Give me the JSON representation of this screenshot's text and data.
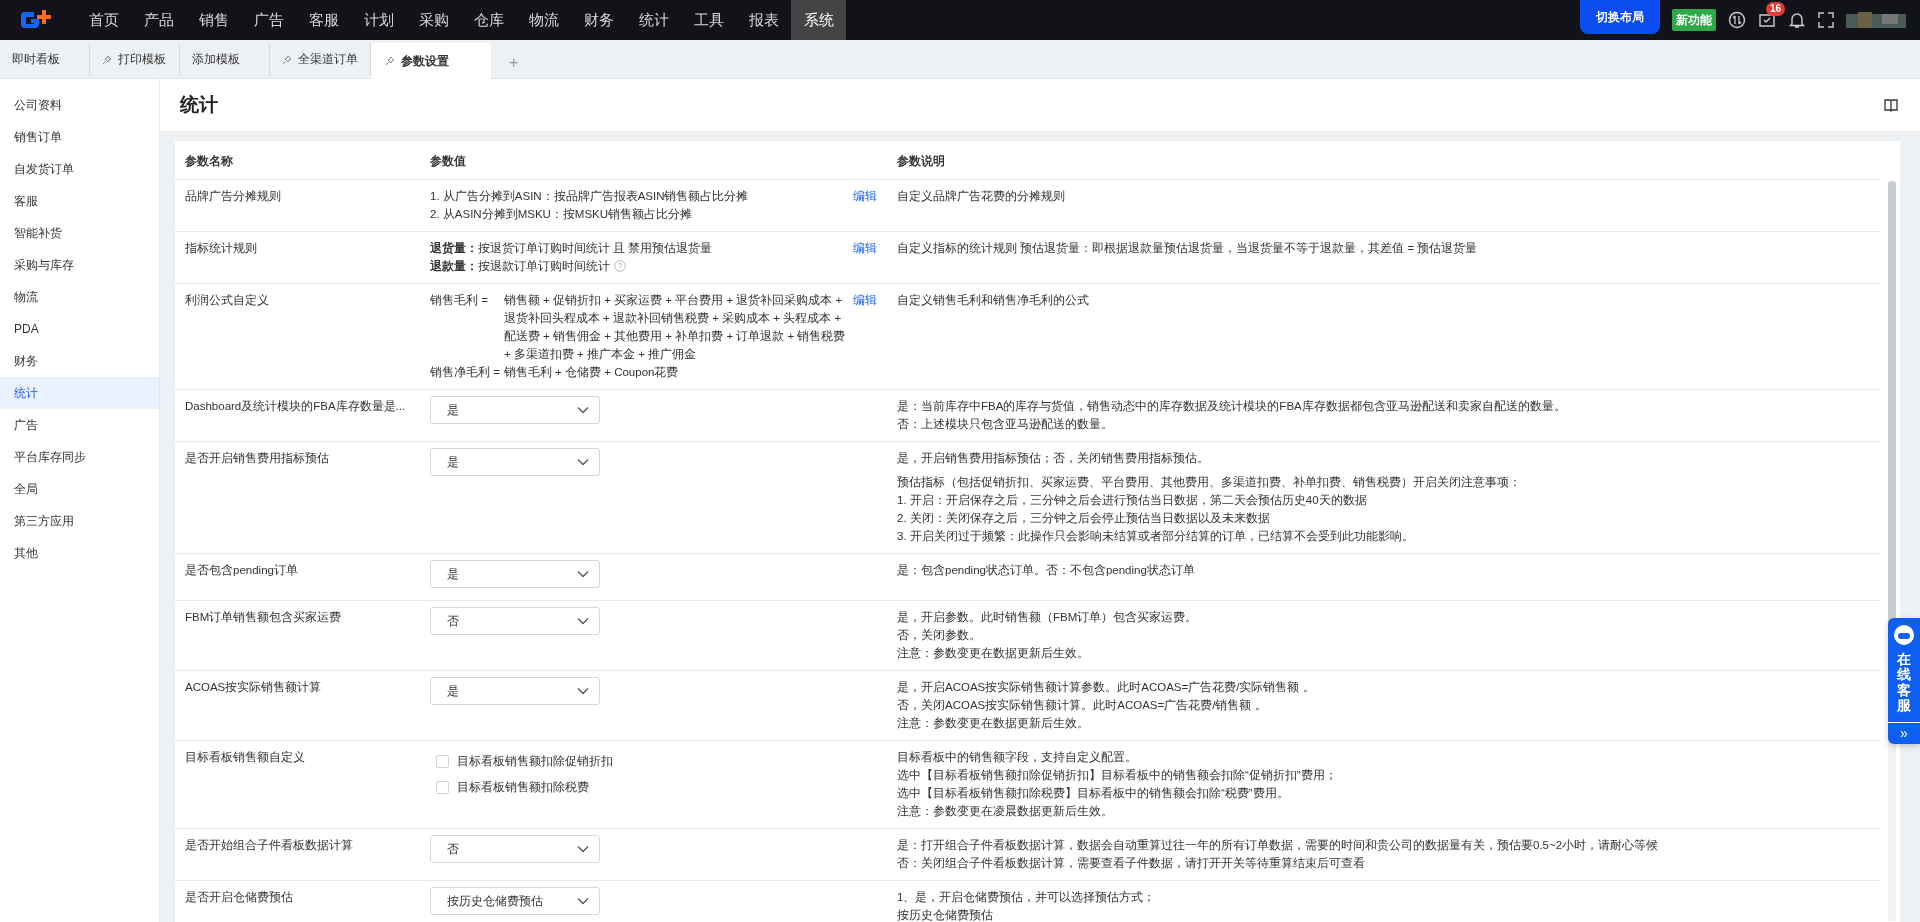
{
  "top_nav": {
    "items": [
      {
        "label": "首页",
        "selected": false
      },
      {
        "label": "产品",
        "selected": false
      },
      {
        "label": "销售",
        "selected": false
      },
      {
        "label": "广告",
        "selected": false
      },
      {
        "label": "客服",
        "selected": false
      },
      {
        "label": "计划",
        "selected": false
      },
      {
        "label": "采购",
        "selected": false
      },
      {
        "label": "仓库",
        "selected": false
      },
      {
        "label": "物流",
        "selected": false
      },
      {
        "label": "财务",
        "selected": false
      },
      {
        "label": "统计",
        "selected": false
      },
      {
        "label": "工具",
        "selected": false
      },
      {
        "label": "报表",
        "selected": false
      },
      {
        "label": "系统",
        "selected": true
      }
    ],
    "switch_layout": "切换布局",
    "new_feature": "新功能",
    "notification_count": "16"
  },
  "tabs": [
    {
      "label": "即时看板",
      "pinned": false,
      "selected": false
    },
    {
      "label": "打印模板",
      "pinned": true,
      "selected": false
    },
    {
      "label": "添加模板",
      "pinned": false,
      "selected": false
    },
    {
      "label": "全渠道订单",
      "pinned": true,
      "selected": false
    },
    {
      "label": "参数设置",
      "pinned": true,
      "selected": true
    }
  ],
  "add_tab": "+",
  "sidebar": {
    "items": [
      {
        "label": "公司资料",
        "selected": false
      },
      {
        "label": "销售订单",
        "selected": false
      },
      {
        "label": "自发货订单",
        "selected": false
      },
      {
        "label": "客服",
        "selected": false
      },
      {
        "label": "智能补货",
        "selected": false
      },
      {
        "label": "采购与库存",
        "selected": false
      },
      {
        "label": "物流",
        "selected": false
      },
      {
        "label": "PDA",
        "selected": false
      },
      {
        "label": "财务",
        "selected": false
      },
      {
        "label": "统计",
        "selected": true
      },
      {
        "label": "广告",
        "selected": false
      },
      {
        "label": "平台库存同步",
        "selected": false
      },
      {
        "label": "全局",
        "selected": false
      },
      {
        "label": "第三方应用",
        "selected": false
      },
      {
        "label": "其他",
        "selected": false
      }
    ]
  },
  "page": {
    "title": "统计"
  },
  "table": {
    "columns": [
      "参数名称",
      "参数值",
      "参数说明"
    ],
    "rows": [
      {
        "name": "品牌广告分摊规则",
        "kind": "rule",
        "lines": [
          {
            "text": "1. 从广告分摊到ASIN：按品牌广告报表ASIN销售额占比分摊",
            "help": false
          },
          {
            "text": "2. 从ASIN分摊到MSKU：按MSKU销售额占比分摊",
            "help": false
          }
        ],
        "edit": "编辑",
        "description": [
          [
            "自定义品牌广告花费的分摊规则"
          ]
        ]
      },
      {
        "name": "指标统计规则",
        "kind": "rule",
        "lines": [
          {
            "text": "**退货量：**按退货订单订购时间统计 且 禁用预估退货量",
            "help": false
          },
          {
            "text": "**退款量：**按退款订单订购时间统计",
            "help": true
          }
        ],
        "edit": "编辑",
        "description": [
          [
            "自定义指标的统计规则 预估退货量：即根据退款量预估退货量，当退货量不等于退款量，其差值 = 预估退货量"
          ]
        ]
      },
      {
        "name": "利润公式自定义",
        "kind": "formula",
        "terms": [
          {
            "term": "销售毛利 =",
            "expr": "销售额 + 促销折扣 + 买家运费 + 平台费用 + 退货补回采购成本 + 退货补回头程成本 + 退款补回销售税费 + 采购成本 + 头程成本 + 配送费 + 销售佣金 + 其他费用 + 补单扣费 + 订单退款 + 销售税费 + 多渠道扣费 + 推广本金 + 推广佣金"
          },
          {
            "term": "销售净毛利 =",
            "expr": "销售毛利 + 仓储费 + Coupon花费"
          }
        ],
        "edit": "编辑",
        "description": [
          [
            "自定义销售毛利和销售净毛利的公式"
          ]
        ]
      },
      {
        "name": "Dashboard及统计模块的FBA库存数量是...",
        "kind": "select",
        "value": "是",
        "description": [
          [
            "是：当前库存中FBA的库存与货值，销售动态中的库存数据及统计模块的FBA库存数据都包含亚马逊配送和卖家自配送的数量。",
            "否：上述模块只包含亚马逊配送的数量。"
          ]
        ]
      },
      {
        "name": "是否开启销售费用指标预估",
        "kind": "select",
        "value": "是",
        "description": [
          [
            "是，开启销售费用指标预估；否，关闭销售费用指标预估。"
          ],
          [
            "预估指标（包括促销折扣、买家运费、平台费用、其他费用、多渠道扣费、补单扣费、销售税费）开启关闭注意事项：",
            "1. 开启：开启保存之后，三分钟之后会进行预估当日数据，第二天会预估历史40天的数据",
            "2. 关闭：关闭保存之后，三分钟之后会停止预估当日数据以及未来数据",
            "3. 开启关闭过于频繁：此操作只会影响未结算或者部分结算的订单，已结算不会受到此功能影响。"
          ]
        ]
      },
      {
        "name": "是否包含pending订单",
        "kind": "select",
        "value": "是",
        "description": [
          [
            "是：包含pending状态订单。否：不包含pending状态订单"
          ]
        ]
      },
      {
        "name": "FBM订单销售额包含买家运费",
        "kind": "select",
        "value": "否",
        "description": [
          [
            "是，开启参数。此时销售额（FBM订单）包含买家运费。",
            "否，关闭参数。",
            "注意：参数变更在数据更新后生效。"
          ]
        ]
      },
      {
        "name": "ACOAS按实际销售额计算",
        "kind": "select",
        "value": "是",
        "description": [
          [
            "是，开启ACOAS按实际销售额计算参数。此时ACOAS=广告花费/实际销售额 。",
            "否，关闭ACOAS按实际销售额计算。此时ACOAS=广告花费/销售额 。",
            "注意：参数变更在数据更新后生效。"
          ]
        ]
      },
      {
        "name": "目标看板销售额自定义",
        "kind": "checkboxes",
        "options": [
          {
            "label": "目标看板销售额扣除促销折扣",
            "checked": false
          },
          {
            "label": "目标看板销售额扣除税费",
            "checked": false
          }
        ],
        "description": [
          [
            "目标看板中的销售额字段，支持自定义配置。",
            "选中【目标看板销售额扣除促销折扣】目标看板中的销售额会扣除“促销折扣”费用；",
            "选中【目标看板销售额扣除税费】目标看板中的销售额会扣除“税费”费用。",
            "注意：参数变更在凌晨数据更新后生效。"
          ]
        ]
      },
      {
        "name": "是否开始组合子件看板数据计算",
        "kind": "select",
        "value": "否",
        "description": [
          [
            "是：打开组合子件看板数据计算，数据会自动重算过往一年的所有订单数据，需要的时间和贵公司的数据量有关，预估要0.5~2小时，请耐心等候",
            "否：关闭组合子件看板数据计算，需要查看子件数据，请打开开关等待重算结束后可查看"
          ]
        ]
      },
      {
        "name": "是否开启仓储费预估",
        "kind": "select",
        "value": "按历史仓储费预估",
        "description": [
          [
            "1、是，开启仓储费预估，并可以选择预估方式；",
            "按历史仓储费预估"
          ]
        ]
      }
    ]
  },
  "service_widget": {
    "label": "在线客服",
    "expand": "»"
  }
}
